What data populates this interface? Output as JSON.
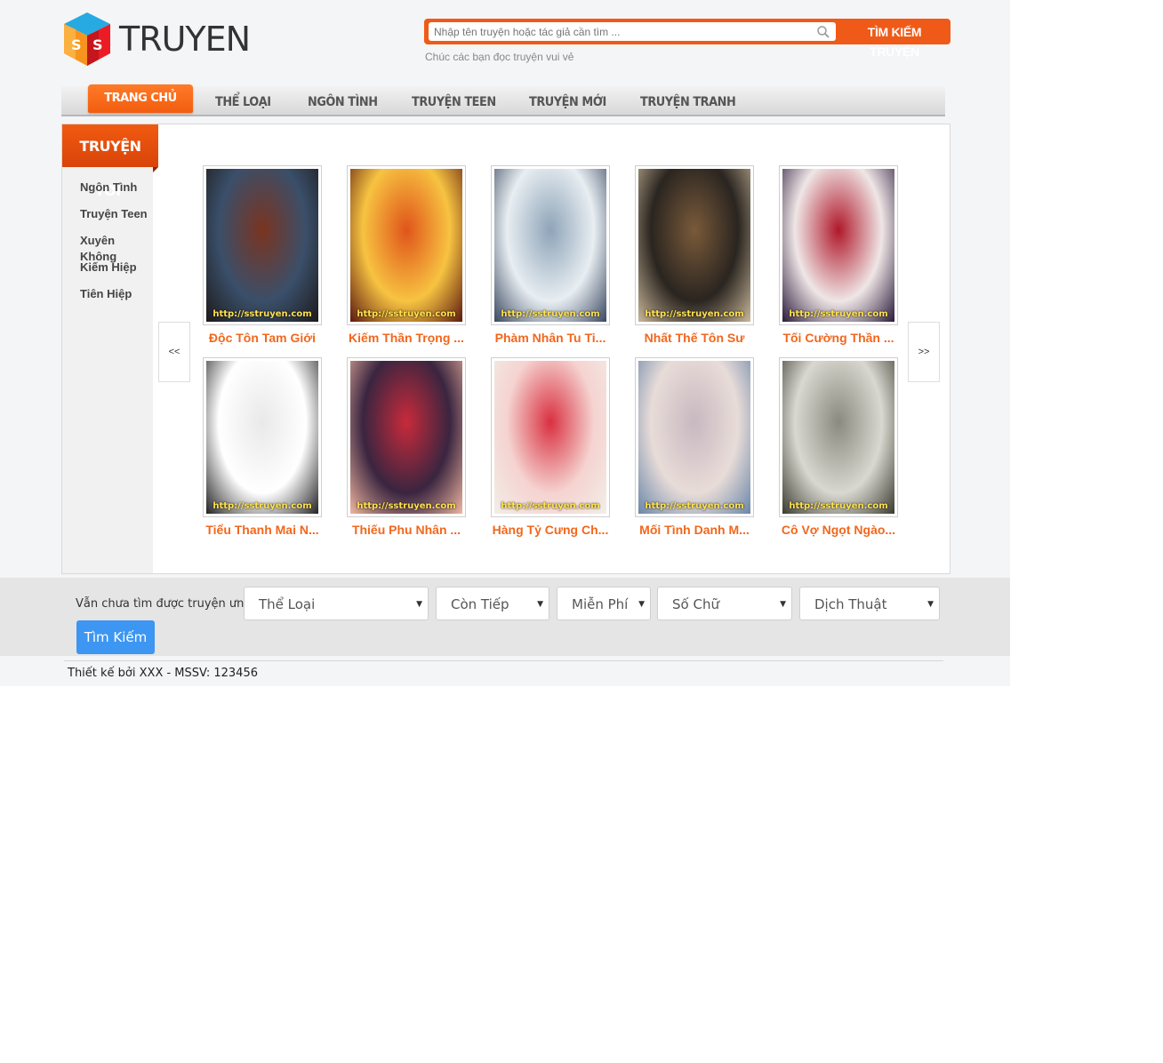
{
  "header": {
    "logo_text": "TRUYEN",
    "search_placeholder": "Nhập tên truyện hoặc tác giả cần tìm ...",
    "search_button": "TÌM KIẾM TRUYỆN",
    "tagline": "Chúc các bạn đọc truyện vui vẻ"
  },
  "nav": {
    "items": [
      {
        "label": "TRANG CHỦ",
        "active": true
      },
      {
        "label": "THỂ LOẠI"
      },
      {
        "label": "NGÔN TÌNH"
      },
      {
        "label": "TRUYỆN TEEN"
      },
      {
        "label": "TRUYỆN MỚI"
      },
      {
        "label": "TRUYỆN TRANH"
      }
    ]
  },
  "sidebar": {
    "title": "TRUYỆN TOP",
    "items": [
      "Ngôn Tình",
      "Truyện Teen",
      "Xuyên Không",
      "Kiếm Hiệp",
      "Tiên Hiệp"
    ]
  },
  "carousel": {
    "prev_label": "<<",
    "next_label": ">>",
    "watermark": "http://sstruyen.com",
    "books": [
      {
        "title": "Độc Tôn Tam Giới",
        "colors": [
          "#3a4f6a",
          "#7a3420",
          "#1d1a1a"
        ]
      },
      {
        "title": "Kiếm Thần Trọng ...",
        "colors": [
          "#f7c341",
          "#e0541a",
          "#5a1a10"
        ]
      },
      {
        "title": "Phàm Nhân Tu Ti...",
        "colors": [
          "#e8eef2",
          "#8ea4b8",
          "#3a4860"
        ]
      },
      {
        "title": "Nhất Thế Tôn Sư",
        "colors": [
          "#2a2520",
          "#7a5a3a",
          "#c9b79a"
        ]
      },
      {
        "title": "Tối Cường Thần ...",
        "colors": [
          "#efe6e6",
          "#b0182a",
          "#2a1a3a"
        ]
      },
      {
        "title": "Tiểu Thanh Mai N...",
        "colors": [
          "#ffffff",
          "#e9e9e9",
          "#222222"
        ]
      },
      {
        "title": "Thiếu Phu Nhân ...",
        "colors": [
          "#3a2540",
          "#c82a3a",
          "#f0b6a0"
        ]
      },
      {
        "title": "Hàng Tỷ Cưng Ch...",
        "colors": [
          "#f5d3d0",
          "#d93040",
          "#f2eee8"
        ]
      },
      {
        "title": "Mối Tình Danh M...",
        "colors": [
          "#e8dcd8",
          "#c8b8c0",
          "#6a86a8"
        ]
      },
      {
        "title": "Cô Vợ Ngọt Ngào...",
        "colors": [
          "#d8d8d0",
          "#8a8a80",
          "#3a3a30"
        ]
      }
    ]
  },
  "filter": {
    "label": "Vẫn chưa tìm được truyện ưng ý?",
    "selects": [
      "Thể Loại",
      "Còn Tiếp",
      "Miễn Phí",
      "Số Chữ",
      "Dịch Thuật"
    ],
    "submit": "Tìm Kiếm"
  },
  "footer": {
    "text": "Thiết kế bởi XXX - MSSV: 123456"
  },
  "colors": {
    "accent": "#f05a18",
    "book_title": "#f2671c",
    "button_blue": "#3d96f2"
  }
}
